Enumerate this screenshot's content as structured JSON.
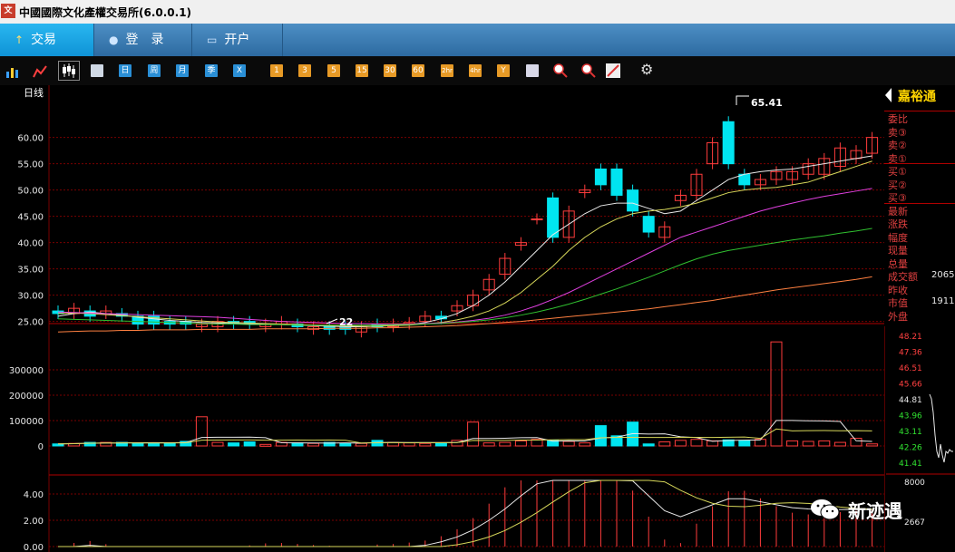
{
  "window": {
    "title": "中國國際文化產權交易所(6.0.0.1)",
    "logo_glyph": "文"
  },
  "nav": {
    "tabs": [
      {
        "label": "交易",
        "icon": "arrow-icon",
        "active": true
      },
      {
        "label": "登　录",
        "icon": "user-icon",
        "active": false
      },
      {
        "label": "开户",
        "icon": "monitor-icon",
        "active": false
      }
    ]
  },
  "toolbar": {
    "period_buttons": [
      "日",
      "周",
      "月",
      "季",
      "X"
    ],
    "minute_buttons": [
      "1",
      "3",
      "5",
      "15",
      "30",
      "60",
      "2hr",
      "4hr",
      "Y"
    ]
  },
  "chart": {
    "period_label": "日线",
    "max_label": "65.41",
    "min_label": "22",
    "price_axis": [
      "60.00",
      "55.00",
      "50.00",
      "45.00",
      "40.00",
      "35.00",
      "30.00",
      "25.00"
    ],
    "volume_axis": [
      "300000",
      "200000",
      "100000",
      "0"
    ],
    "macd_axis": [
      "4.00",
      "2.00",
      "0.00"
    ],
    "colors": {
      "up": "#ff3c3c",
      "down": "#00e5f0",
      "grid": "#7a0000",
      "ma5": "#e8e8e8",
      "ma10": "#d8d85a",
      "ma20": "#e040e0",
      "ma30": "#30c030",
      "ma60": "#ff8040"
    }
  },
  "chart_data": {
    "type": "candlestick",
    "ylim": [
      22,
      66
    ],
    "candles": [
      {
        "o": 27,
        "c": 26.5
      },
      {
        "o": 26.5,
        "c": 27.5
      },
      {
        "o": 27,
        "c": 26
      },
      {
        "o": 26.5,
        "c": 27
      },
      {
        "o": 26.5,
        "c": 26
      },
      {
        "o": 26,
        "c": 24.5
      },
      {
        "o": 26,
        "c": 24.5
      },
      {
        "o": 25,
        "c": 24.5
      },
      {
        "o": 25,
        "c": 24.5
      },
      {
        "o": 24,
        "c": 24.5
      },
      {
        "o": 24,
        "c": 25
      },
      {
        "o": 25,
        "c": 24.5
      },
      {
        "o": 25,
        "c": 24.5
      },
      {
        "o": 24,
        "c": 24.5
      },
      {
        "o": 24.5,
        "c": 25
      },
      {
        "o": 24.5,
        "c": 24
      },
      {
        "o": 23.5,
        "c": 24
      },
      {
        "o": 24,
        "c": 23.5
      },
      {
        "o": 24,
        "c": 23.5
      },
      {
        "o": 23,
        "c": 24
      },
      {
        "o": 24.5,
        "c": 24
      },
      {
        "o": 24,
        "c": 24.5
      },
      {
        "o": 24.5,
        "c": 24.8
      },
      {
        "o": 25,
        "c": 26
      },
      {
        "o": 26,
        "c": 25.5
      },
      {
        "o": 27,
        "c": 28
      },
      {
        "o": 28,
        "c": 30
      },
      {
        "o": 31,
        "c": 33
      },
      {
        "o": 34,
        "c": 37
      },
      {
        "o": 39.5,
        "c": 40
      },
      {
        "o": 44.5,
        "c": 44.5
      },
      {
        "o": 48.5,
        "c": 41
      },
      {
        "o": 41,
        "c": 46
      },
      {
        "o": 49.5,
        "c": 50
      },
      {
        "o": 54,
        "c": 51
      },
      {
        "o": 54,
        "c": 49
      },
      {
        "o": 50,
        "c": 46
      },
      {
        "o": 45,
        "c": 42
      },
      {
        "o": 41,
        "c": 43
      },
      {
        "o": 48,
        "c": 49
      },
      {
        "o": 49,
        "c": 53
      },
      {
        "o": 55,
        "c": 59
      },
      {
        "o": 63,
        "c": 55
      },
      {
        "o": 53,
        "c": 51
      },
      {
        "o": 51,
        "c": 52
      },
      {
        "o": 52,
        "c": 53.5
      },
      {
        "o": 52,
        "c": 53.5
      },
      {
        "o": 53,
        "c": 55
      },
      {
        "o": 53,
        "c": 56
      },
      {
        "o": 54.5,
        "c": 58
      },
      {
        "o": 56,
        "c": 57.5
      },
      {
        "o": 57,
        "c": 60
      }
    ],
    "volume": [
      8000,
      10000,
      14000,
      14000,
      14000,
      10000,
      12000,
      12000,
      18000,
      115000,
      14000,
      12000,
      16000,
      6000,
      14000,
      12000,
      10000,
      14000,
      10000,
      10000,
      22000,
      14000,
      12000,
      10000,
      10000,
      22000,
      94000,
      12000,
      14000,
      20000,
      26000,
      22000,
      18000,
      12000,
      80000,
      40000,
      94000,
      8000,
      16000,
      22000,
      26000,
      20000,
      24000,
      22000,
      26000,
      410000,
      20000,
      18000,
      20000,
      14000,
      30000,
      8000
    ],
    "ma5": [
      26,
      26.5,
      26.8,
      26.5,
      26.2,
      25.8,
      25.5,
      25.2,
      25,
      24.8,
      24.7,
      24.6,
      24.5,
      24.5,
      24.4,
      24.3,
      24.2,
      24.1,
      24,
      24,
      24.1,
      24.2,
      24.4,
      24.8,
      25.5,
      26.5,
      28,
      30,
      32.5,
      35.5,
      38.5,
      41.5,
      43.5,
      45.5,
      47,
      47.5,
      47.5,
      46.5,
      45.5,
      46,
      48,
      50,
      52,
      53,
      53.5,
      53.8,
      54,
      54.5,
      55,
      55.5,
      56,
      56.5
    ],
    "ma10": [
      26.5,
      26.6,
      26.5,
      26.3,
      26.1,
      25.9,
      25.7,
      25.5,
      25.3,
      25.1,
      24.9,
      24.8,
      24.7,
      24.6,
      24.5,
      24.4,
      24.3,
      24.2,
      24.2,
      24.1,
      24.1,
      24.2,
      24.3,
      24.5,
      24.8,
      25.3,
      26,
      27,
      28.5,
      30.5,
      33,
      35.5,
      38.5,
      41,
      43,
      44.5,
      45.5,
      46,
      46.3,
      46.8,
      47.5,
      48.5,
      49.5,
      50,
      50.3,
      50.5,
      51,
      51.5,
      52.5,
      53.5,
      54.5,
      55.5
    ],
    "ma20": [
      26.8,
      26.7,
      26.6,
      26.5,
      26.4,
      26.3,
      26.2,
      26.1,
      26,
      25.9,
      25.8,
      25.6,
      25.4,
      25.2,
      25,
      24.9,
      24.8,
      24.7,
      24.6,
      24.6,
      24.5,
      24.5,
      24.5,
      24.6,
      24.7,
      24.9,
      25.2,
      25.6,
      26.2,
      27,
      28,
      29.2,
      30.5,
      32,
      33.5,
      35,
      36.5,
      38,
      39.5,
      41,
      42,
      43,
      44,
      45,
      46,
      46.8,
      47.5,
      48.2,
      48.8,
      49.3,
      49.8,
      50.3
    ],
    "ma30": [
      25.5,
      25.4,
      25.3,
      25.2,
      25.1,
      25,
      24.9,
      24.8,
      24.7,
      24.6,
      24.5,
      24.5,
      24.4,
      24.4,
      24.4,
      24.3,
      24.3,
      24.3,
      24.3,
      24.3,
      24.3,
      24.4,
      24.4,
      24.5,
      24.6,
      24.8,
      25,
      25.3,
      25.7,
      26.2,
      26.8,
      27.5,
      28.3,
      29.2,
      30.2,
      31.2,
      32.3,
      33.4,
      34.6,
      35.8,
      36.9,
      37.8,
      38.5,
      39,
      39.5,
      40,
      40.5,
      40.9,
      41.3,
      41.8,
      42.2,
      42.7
    ],
    "ma60": [
      23,
      23.1,
      23.2,
      23.2,
      23.3,
      23.3,
      23.4,
      23.4,
      23.4,
      23.5,
      23.5,
      23.5,
      23.5,
      23.6,
      23.6,
      23.6,
      23.6,
      23.7,
      23.7,
      23.7,
      23.8,
      23.8,
      23.9,
      24,
      24.1,
      24.2,
      24.4,
      24.6,
      24.8,
      25,
      25.3,
      25.6,
      25.9,
      26.2,
      26.5,
      26.8,
      27.1,
      27.4,
      27.8,
      28.2,
      28.6,
      29,
      29.5,
      30,
      30.5,
      31,
      31.4,
      31.8,
      32.2,
      32.6,
      33,
      33.5
    ]
  },
  "quote_panel": {
    "brand": "嘉裕通",
    "rows": [
      {
        "label": "委比",
        "value": ""
      },
      {
        "label": "卖③",
        "value": ""
      },
      {
        "label": "卖②",
        "value": ""
      },
      {
        "label": "卖①",
        "value": ""
      },
      {
        "label": "买①",
        "value": ""
      },
      {
        "label": "买②",
        "value": ""
      },
      {
        "label": "买③",
        "value": ""
      },
      {
        "label": "最新",
        "value": ""
      },
      {
        "label": "涨跌",
        "value": ""
      },
      {
        "label": "幅度",
        "value": ""
      },
      {
        "label": "现量",
        "value": ""
      },
      {
        "label": "总量",
        "value": ""
      },
      {
        "label": "成交额",
        "value": "2065"
      },
      {
        "label": "昨收",
        "value": ""
      },
      {
        "label": "市值",
        "value": "1911"
      },
      {
        "label": "外盘",
        "value": ""
      }
    ],
    "mini_axis": [
      "48.21",
      "47.36",
      "46.51",
      "45.66",
      "44.81",
      "43.96",
      "43.11",
      "42.26",
      "41.41"
    ],
    "mini_vol_axis": [
      "8000",
      "2667"
    ]
  },
  "watermark": {
    "text": "新迹遇"
  }
}
